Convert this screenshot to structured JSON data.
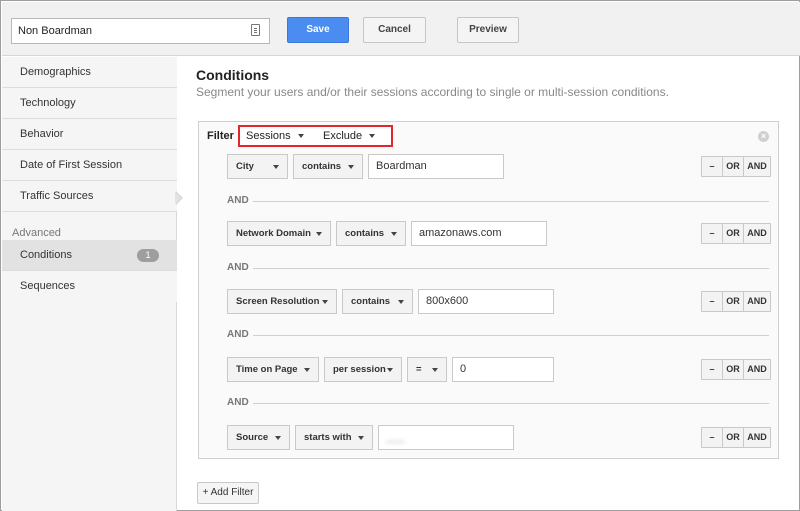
{
  "header": {
    "segment_name": "Non Boardman",
    "save_label": "Save",
    "cancel_label": "Cancel",
    "preview_label": "Preview"
  },
  "sidebar": {
    "items": [
      {
        "label": "Demographics"
      },
      {
        "label": "Technology"
      },
      {
        "label": "Behavior"
      },
      {
        "label": "Date of First Session"
      },
      {
        "label": "Traffic Sources"
      }
    ],
    "advanced_heading": "Advanced",
    "advanced_items": [
      {
        "label": "Conditions",
        "badge": "1",
        "active": true
      },
      {
        "label": "Sequences"
      }
    ]
  },
  "main": {
    "title": "Conditions",
    "subtitle": "Segment your users and/or their sessions according to single or multi-session conditions.",
    "filter": {
      "label": "Filter",
      "scope": "Sessions",
      "mode": "Exclude"
    },
    "conditions": [
      {
        "dimension": "City",
        "operator": "contains",
        "value": "Boardman"
      },
      {
        "dimension": "Network Domain",
        "operator": "contains",
        "value": "amazonaws.com"
      },
      {
        "dimension": "Screen Resolution",
        "operator": "contains",
        "value": "800x600"
      },
      {
        "dimension": "Time on Page",
        "operator": "per session",
        "comparator": "=",
        "value": "0"
      },
      {
        "dimension": "Source",
        "operator": "starts with",
        "value": "___"
      }
    ],
    "connector": "AND",
    "row_controls": {
      "remove": "–",
      "or": "OR",
      "and": "AND"
    },
    "add_filter_label": "+ Add Filter"
  },
  "colors": {
    "save_button": "#4a8cf0",
    "filter_highlight": "#e0282c"
  }
}
